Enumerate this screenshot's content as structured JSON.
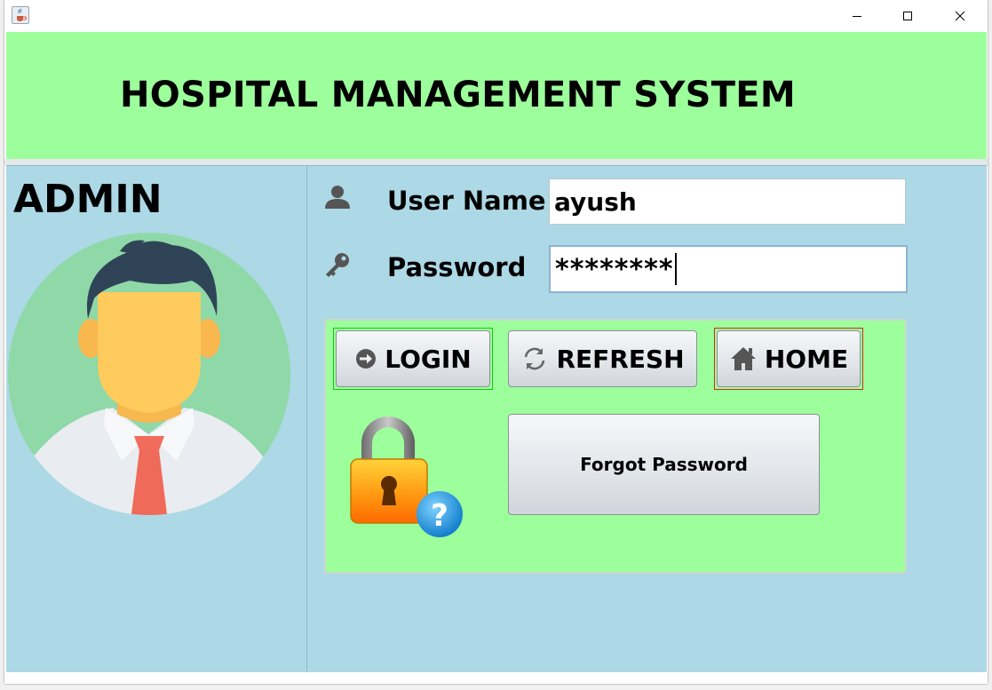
{
  "window": {
    "icon": "java-cup-icon",
    "controls": [
      "minimize-icon",
      "maximize-icon",
      "close-icon"
    ]
  },
  "banner": {
    "title": "HOSPITAL MANAGEMENT SYSTEM",
    "background": "#9dff9c"
  },
  "left_panel": {
    "label": "ADMIN",
    "avatar_icon": "admin-avatar-icon"
  },
  "form": {
    "username_label": "User Name",
    "username_value": "ayush",
    "password_label": "Password",
    "password_value": "********"
  },
  "buttons": {
    "login": "LOGIN",
    "refresh": "REFRESH",
    "home": "HOME",
    "forgot": "Forgot Password"
  },
  "colors": {
    "banner": "#9dff9c",
    "content": "#add8e6",
    "button_panel": "#9dff9c",
    "login_focus_border": "#17c617",
    "home_border": "#d02a1a"
  }
}
